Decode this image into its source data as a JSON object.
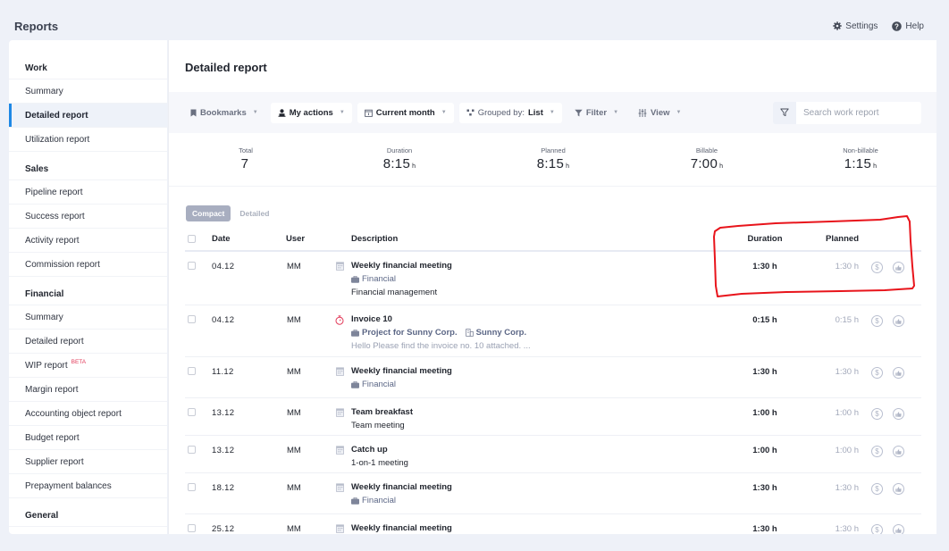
{
  "header": {
    "title": "Reports",
    "settings_label": "Settings",
    "help_label": "Help"
  },
  "sidebar": {
    "sections": [
      {
        "title": "Work",
        "items": [
          {
            "label": "Summary",
            "active": false
          },
          {
            "label": "Detailed report",
            "active": true
          },
          {
            "label": "Utilization report",
            "active": false
          }
        ]
      },
      {
        "title": "Sales",
        "items": [
          {
            "label": "Pipeline report",
            "active": false
          },
          {
            "label": "Success report",
            "active": false
          },
          {
            "label": "Activity report",
            "active": false
          },
          {
            "label": "Commission report",
            "active": false
          }
        ]
      },
      {
        "title": "Financial",
        "items": [
          {
            "label": "Summary",
            "active": false
          },
          {
            "label": "Detailed report",
            "active": false
          },
          {
            "label": "WIP report",
            "badge": "BETA",
            "active": false
          },
          {
            "label": "Margin report",
            "active": false
          },
          {
            "label": "Accounting object report",
            "active": false
          },
          {
            "label": "Budget report",
            "active": false
          },
          {
            "label": "Supplier report",
            "active": false
          },
          {
            "label": "Prepayment balances",
            "active": false
          }
        ]
      },
      {
        "title": "General",
        "items": []
      }
    ]
  },
  "main": {
    "title": "Detailed report",
    "toolbar": {
      "bookmarks": "Bookmarks",
      "my_actions": "My actions",
      "current_month": "Current month",
      "grouped_by_prefix": "Grouped by:",
      "grouped_by_value": "List",
      "filter": "Filter",
      "view": "View",
      "search_placeholder": "Search work report"
    },
    "stats": [
      {
        "label": "Total",
        "value": "7",
        "unit": ""
      },
      {
        "label": "Duration",
        "value": "8:15",
        "unit": "h"
      },
      {
        "label": "Planned",
        "value": "8:15",
        "unit": "h"
      },
      {
        "label": "Billable",
        "value": "7:00",
        "unit": "h"
      },
      {
        "label": "Non-billable",
        "value": "1:15",
        "unit": "h"
      }
    ],
    "view_tabs": [
      {
        "label": "Compact",
        "active": true
      },
      {
        "label": "Detailed",
        "active": false
      }
    ],
    "columns": {
      "date": "Date",
      "user": "User",
      "description": "Description",
      "duration": "Duration",
      "planned": "Planned"
    },
    "rows": [
      {
        "date": "04.12",
        "user": "MM",
        "icon": "calendar-icon",
        "title": "Weekly financial meeting",
        "project": "Financial",
        "note": "Financial management",
        "duration": "1:30 h",
        "planned": "1:30 h"
      },
      {
        "date": "04.12",
        "user": "MM",
        "icon": "stopwatch-icon",
        "title": "Invoice 10",
        "project": "Project for Sunny Corp.",
        "client": "Sunny Corp.",
        "message": "Hello   Please find the invoice no. 10 attached.  ...",
        "duration": "0:15 h",
        "planned": "0:15 h"
      },
      {
        "date": "11.12",
        "user": "MM",
        "icon": "calendar-icon",
        "title": "Weekly financial meeting",
        "project": "Financial",
        "duration": "1:30 h",
        "planned": "1:30 h"
      },
      {
        "date": "13.12",
        "user": "MM",
        "icon": "calendar-icon",
        "title": "Team breakfast",
        "note": "Team meeting",
        "duration": "1:00 h",
        "planned": "1:00 h"
      },
      {
        "date": "13.12",
        "user": "MM",
        "icon": "calendar-icon",
        "title": "Catch up",
        "note": "1-on-1 meeting",
        "duration": "1:00 h",
        "planned": "1:00 h"
      },
      {
        "date": "18.12",
        "user": "MM",
        "icon": "calendar-icon",
        "title": "Weekly financial meeting",
        "project": "Financial",
        "duration": "1:30 h",
        "planned": "1:30 h"
      },
      {
        "date": "25.12",
        "user": "MM",
        "icon": "calendar-icon",
        "title": "Weekly financial meeting",
        "duration": "1:30 h",
        "planned": "1:30 h"
      }
    ]
  },
  "colors": {
    "accent": "#1e88e5",
    "beta_badge": "#e23b5a",
    "stopwatch": "#e23b5a",
    "annotation": "#e8141b",
    "page_bg": "#eef1f8"
  }
}
